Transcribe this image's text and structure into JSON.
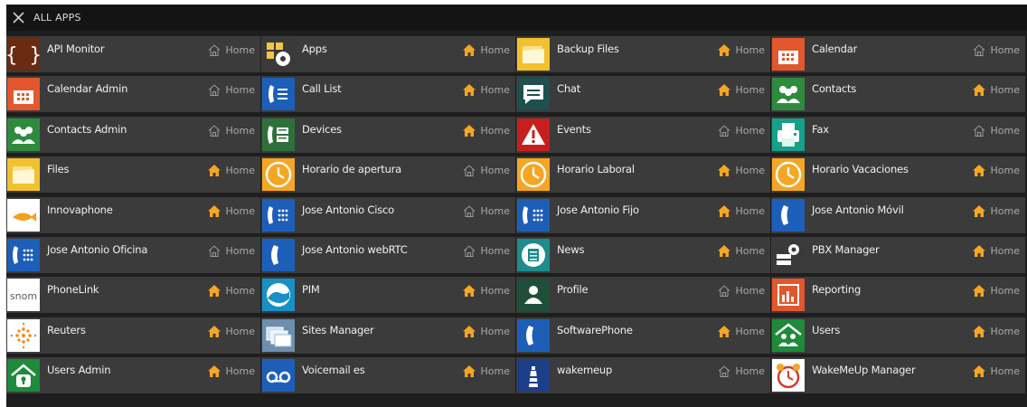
{
  "header": {
    "title": "ALL APPS",
    "close_icon": "close-icon"
  },
  "colors": {
    "home_active": "#f5a623",
    "home_inactive": "#9a9a9a",
    "tile_bg": "#3b3b3b",
    "frame_bg": "#1e1e1e"
  },
  "apps": [
    {
      "name": "API Monitor",
      "icon": "braces-icon",
      "home": "Home",
      "home_active": false
    },
    {
      "name": "Apps",
      "icon": "apps-gear-icon",
      "home": "Home",
      "home_active": true
    },
    {
      "name": "Backup Files",
      "icon": "folder-files-icon",
      "home": "Home",
      "home_active": true
    },
    {
      "name": "Calendar",
      "icon": "calendar-icon",
      "home": "Home",
      "home_active": false
    },
    {
      "name": "Calendar Admin",
      "icon": "calendar-icon",
      "home": "Home",
      "home_active": false
    },
    {
      "name": "Call List",
      "icon": "call-list-icon",
      "home": "Home",
      "home_active": true
    },
    {
      "name": "Chat",
      "icon": "chat-icon",
      "home": "Home",
      "home_active": true
    },
    {
      "name": "Contacts",
      "icon": "contacts-icon",
      "home": "Home",
      "home_active": true
    },
    {
      "name": "Contacts Admin",
      "icon": "contacts-icon",
      "home": "Home",
      "home_active": false
    },
    {
      "name": "Devices",
      "icon": "devices-icon",
      "home": "Home",
      "home_active": true
    },
    {
      "name": "Events",
      "icon": "events-alert-icon",
      "home": "Home",
      "home_active": false
    },
    {
      "name": "Fax",
      "icon": "fax-icon",
      "home": "Home",
      "home_active": false
    },
    {
      "name": "Files",
      "icon": "folder-files-icon",
      "home": "Home",
      "home_active": true
    },
    {
      "name": "Horario de apertura",
      "icon": "clock-icon",
      "home": "Home",
      "home_active": false
    },
    {
      "name": "Horario Laboral",
      "icon": "clock-icon",
      "home": "Home",
      "home_active": true
    },
    {
      "name": "Horario Vacaciones",
      "icon": "clock-icon",
      "home": "Home",
      "home_active": true
    },
    {
      "name": "Innovaphone",
      "icon": "fish-icon",
      "home": "Home",
      "home_active": true
    },
    {
      "name": "Jose Antonio Cisco",
      "icon": "phone-keypad-icon",
      "home": "Home",
      "home_active": false
    },
    {
      "name": "Jose Antonio Fijo",
      "icon": "phone-keypad-icon",
      "home": "Home",
      "home_active": true
    },
    {
      "name": "Jose Antonio Móvil",
      "icon": "phone-icon",
      "home": "Home",
      "home_active": true
    },
    {
      "name": "Jose Antonio Oficina",
      "icon": "phone-keypad-icon",
      "home": "Home",
      "home_active": false
    },
    {
      "name": "Jose Antonio webRTC",
      "icon": "phone-icon",
      "home": "Home",
      "home_active": false
    },
    {
      "name": "News",
      "icon": "news-icon",
      "home": "Home",
      "home_active": true
    },
    {
      "name": "PBX Manager",
      "icon": "pbx-manager-icon",
      "home": "Home",
      "home_active": true
    },
    {
      "name": "PhoneLink",
      "icon": "snom-logo-icon",
      "home": "Home",
      "home_active": true
    },
    {
      "name": "PIM",
      "icon": "pim-wave-icon",
      "home": "Home",
      "home_active": true
    },
    {
      "name": "Profile",
      "icon": "profile-icon",
      "home": "Home",
      "home_active": false
    },
    {
      "name": "Reporting",
      "icon": "reporting-chart-icon",
      "home": "Home",
      "home_active": true
    },
    {
      "name": "Reuters",
      "icon": "reuters-logo-icon",
      "home": "Home",
      "home_active": true
    },
    {
      "name": "Sites Manager",
      "icon": "sites-manager-icon",
      "home": "Home",
      "home_active": true
    },
    {
      "name": "SoftwarePhone",
      "icon": "phone-icon",
      "home": "Home",
      "home_active": true
    },
    {
      "name": "Users",
      "icon": "users-home-icon",
      "home": "Home",
      "home_active": true
    },
    {
      "name": "Users Admin",
      "icon": "user-lock-icon",
      "home": "Home",
      "home_active": true
    },
    {
      "name": "Voicemail es",
      "icon": "voicemail-icon",
      "home": "Home",
      "home_active": true
    },
    {
      "name": "wakemeup",
      "icon": "lighthouse-icon",
      "home": "Home",
      "home_active": false
    },
    {
      "name": "WakeMeUp Manager",
      "icon": "alarm-clock-icon",
      "home": "Home",
      "home_active": true
    }
  ]
}
